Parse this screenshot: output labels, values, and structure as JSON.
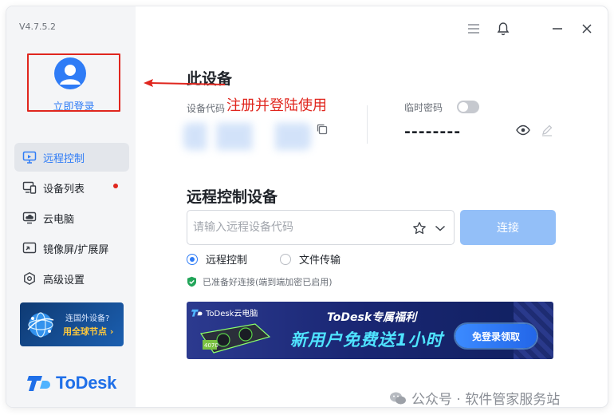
{
  "app": {
    "version": "V4.7.5.2",
    "brand_name": "ToDesk"
  },
  "sidebar": {
    "login_label": "立即登录",
    "items": [
      {
        "label": "远程控制",
        "icon": "remote-control-icon",
        "active": true
      },
      {
        "label": "设备列表",
        "icon": "device-list-icon",
        "badge": true
      },
      {
        "label": "云电脑",
        "icon": "cloud-pc-icon"
      },
      {
        "label": "镜像屏/扩展屏",
        "icon": "mirror-screen-icon"
      },
      {
        "label": "高级设置",
        "icon": "advanced-settings-icon"
      }
    ],
    "promo": {
      "line1": "连国外设备?",
      "line2": "用全球节点 ›"
    }
  },
  "annotation": {
    "text": "注册并登陆使用",
    "color": "#e0261e"
  },
  "this_device": {
    "title": "此设备",
    "code_label": "设备代码",
    "temp_password_label": "临时密码",
    "temp_password_value": "--------",
    "temp_password_toggle": false
  },
  "remote": {
    "title": "远程控制设备",
    "input_placeholder": "请输入远程设备代码",
    "input_value": "",
    "connect_label": "连接",
    "options": [
      {
        "label": "远程控制",
        "selected": true
      },
      {
        "label": "文件传输",
        "selected": false
      }
    ],
    "status_text": "已准备好连接(端到端加密已启用)"
  },
  "banner": {
    "brand": "ToDesk云电脑",
    "headline": "ToDesk专属福利",
    "big_text": "新用户免费送1小时",
    "cta_label": "免登录领取",
    "gpu_label": "4070"
  },
  "watermark": {
    "text": "公众号 · 软件管家服务站"
  },
  "colors": {
    "accent": "#2f7cf6",
    "annotation_red": "#e0261e",
    "connect_disabled": "#93bff8",
    "status_green": "#22a559"
  }
}
